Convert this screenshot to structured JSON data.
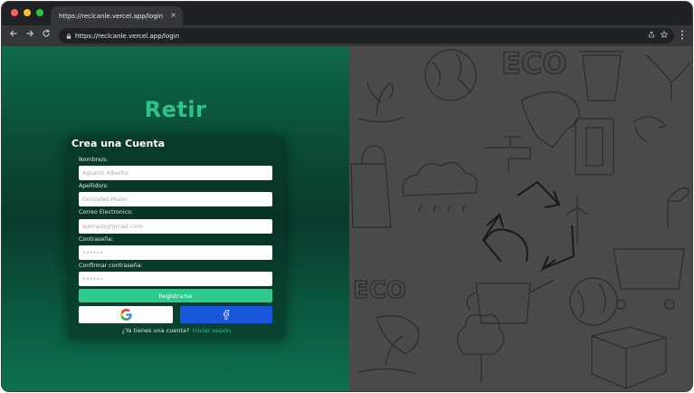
{
  "browser": {
    "tab_title": "https://reclcanle.vercel.app/login",
    "tab_close_glyph": "×",
    "url": "https://reclcanle.vercel.app/login",
    "window_dot_colors": [
      "#ff5f57",
      "#febc2e",
      "#28c840"
    ],
    "icons": {
      "back": "arrow-left-icon",
      "forward": "arrow-right-icon",
      "reload": "reload-icon",
      "lock": "lock-icon",
      "share": "share-icon",
      "bookmark": "star-icon",
      "menu": "kebab-menu-icon"
    }
  },
  "page": {
    "brand": "Retir",
    "form": {
      "title": "Crea una Cuenta",
      "fields": [
        {
          "label": "Nombre/s:",
          "placeholder": "Agustin Alberto"
        },
        {
          "label": "Apellido/s:",
          "placeholder": "Gonzalez Matei"
        },
        {
          "label": "Correo Electronico:",
          "placeholder": "ejemplo@gmail.com"
        },
        {
          "label": "Contraseña:",
          "placeholder": "••••••"
        },
        {
          "label": "Confirmar contraseña:",
          "placeholder": "••••••"
        }
      ],
      "register_label": "Registrarse",
      "social": {
        "google": "google-icon",
        "facebook": "facebook-icon"
      },
      "login_prompt": "¿Ya tienes una cuenta?",
      "login_link": "Iniciar sesión"
    },
    "background_illustration": "eco-recycling-doodle-pattern",
    "colors": {
      "brand_green": "#2fc28a",
      "register_button": "#2dcb8c",
      "facebook_blue": "#1a56db",
      "illustration_bg": "#4a4a4a"
    }
  }
}
